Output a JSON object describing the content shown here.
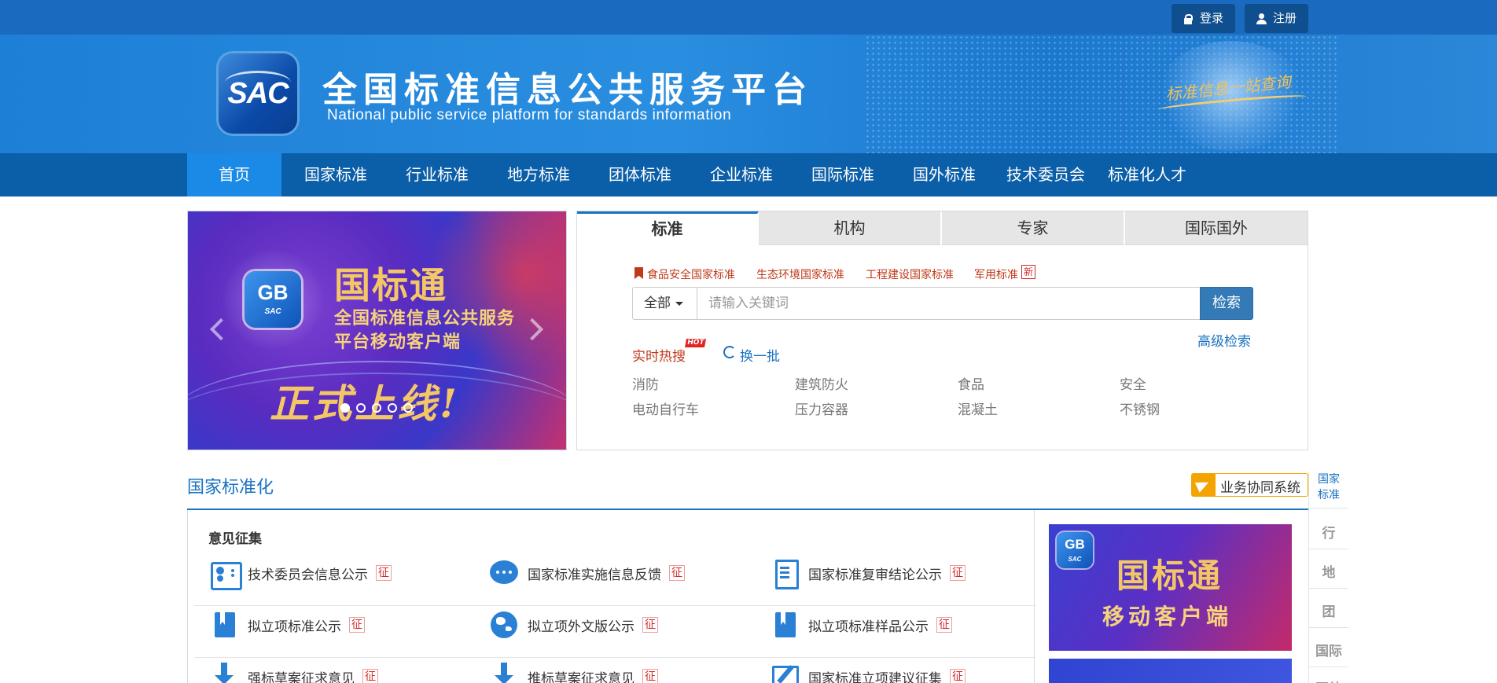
{
  "topbar": {
    "login_label": "登录",
    "register_label": "注册",
    "login_icon": "lock-icon",
    "register_icon": "user-icon"
  },
  "header": {
    "logo_text": "SAC",
    "title": "全国标准信息公共服务平台",
    "subtitle": "National public service platform  for standards information",
    "slogan": "标准信息一站查询"
  },
  "nav": {
    "items": [
      {
        "label": "首页",
        "active": true
      },
      {
        "label": "国家标准"
      },
      {
        "label": "行业标准"
      },
      {
        "label": "地方标准"
      },
      {
        "label": "团体标准"
      },
      {
        "label": "企业标准"
      },
      {
        "label": "国际标准"
      },
      {
        "label": "国外标准"
      },
      {
        "label": "技术委员会"
      },
      {
        "label": "标准化人才"
      }
    ]
  },
  "carousel": {
    "app_badge": "GB",
    "app_sub": "SAC",
    "title": "国标通",
    "line1": "全国标准信息公共服务",
    "line2": "平台移动客户端",
    "launch": "正式上线!",
    "slide_count": 5,
    "active_slide": 1
  },
  "search": {
    "tabs": [
      "标准",
      "机构",
      "专家",
      "国际国外"
    ],
    "active_tab": "标准",
    "quick_links": [
      "食品安全国家标准",
      "生态环境国家标准",
      "工程建设国家标准",
      "军用标准"
    ],
    "new_badge": "新",
    "scope": "全部",
    "placeholder": "请输入关键词",
    "button": "检索",
    "advanced": "高级检索",
    "hot_label": "实时热搜",
    "hot_badge": "HOT",
    "refresh_label": "换一批",
    "keywords": [
      "消防",
      "建筑防火",
      "食品",
      "安全",
      "电动自行车",
      "压力容器",
      "混凝土",
      "不锈钢"
    ]
  },
  "section": {
    "title": "国家标准化",
    "collab_label": "业务协同系统",
    "subtitle": "意见征集",
    "badge": "征",
    "items": [
      {
        "label": "技术委员会信息公示",
        "icon": "id-card-icon"
      },
      {
        "label": "国家标准实施信息反馈",
        "icon": "chat-icon"
      },
      {
        "label": "国家标准复审结论公示",
        "icon": "document-icon"
      },
      {
        "label": "拟立项标准公示",
        "icon": "book-icon"
      },
      {
        "label": "拟立项外文版公示",
        "icon": "globe-icon"
      },
      {
        "label": "拟立项标准样品公示",
        "icon": "book-icon"
      },
      {
        "label": "强标草案征求意见",
        "icon": "download-icon"
      },
      {
        "label": "推标草案征求意见",
        "icon": "download-icon"
      },
      {
        "label": "国家标准立项建议征集",
        "icon": "edit-icon"
      }
    ]
  },
  "ad": {
    "app_badge": "GB",
    "app_sub": "SAC",
    "title": "国标通",
    "subtitle": "移动客户端"
  },
  "side_nav": {
    "items": [
      "国家标准",
      "行",
      "地",
      "团",
      "国际",
      "国外"
    ]
  },
  "colors": {
    "brand_blue": "#1a72c2",
    "nav_blue": "#0b5ea8",
    "accent_red": "#c0391a"
  }
}
